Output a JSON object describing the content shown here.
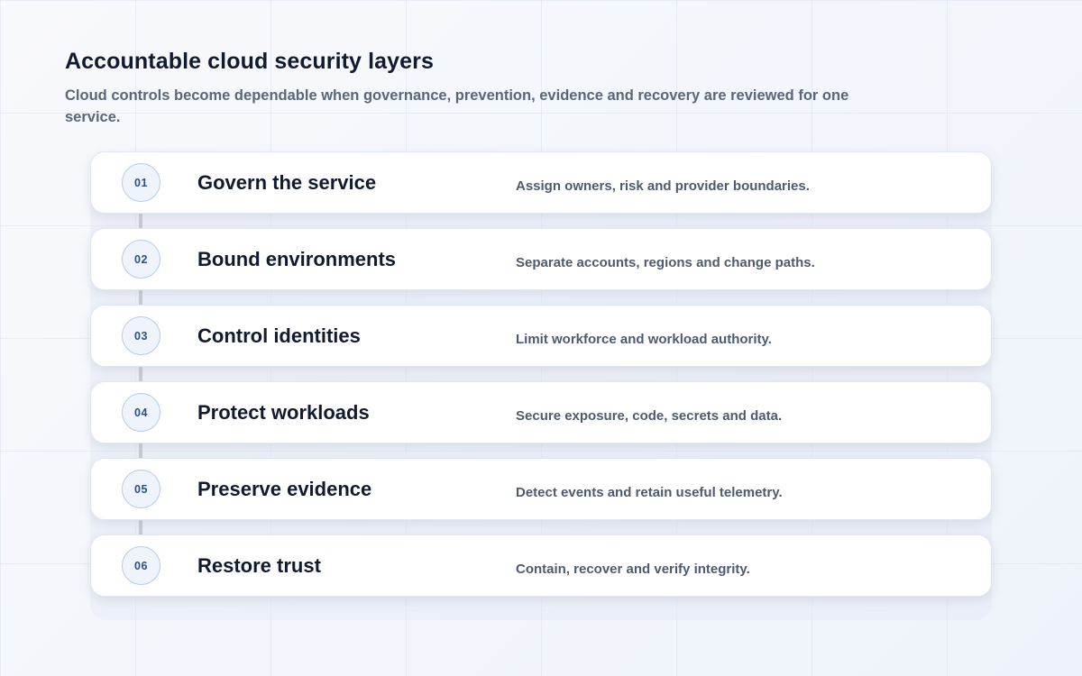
{
  "header": {
    "title": "Accountable cloud security layers",
    "subtitle": "Cloud controls become dependable when governance, prevention, evidence and recovery are reviewed for one service."
  },
  "colors": {
    "background": "#f5f7fb",
    "card": "#ffffff",
    "badge_fill": "#eff4fc",
    "badge_border": "#b6cbe9",
    "badge_text": "#2e4f86",
    "connector": "#c9ccd3",
    "title_text": "#111a2e",
    "description_text": "#4e5a70"
  },
  "layers": [
    {
      "number": "01",
      "name": "Govern the service",
      "description": "Assign owners, risk and provider boundaries."
    },
    {
      "number": "02",
      "name": "Bound environments",
      "description": "Separate accounts, regions and change paths."
    },
    {
      "number": "03",
      "name": "Control identities",
      "description": "Limit workforce and workload authority."
    },
    {
      "number": "04",
      "name": "Protect workloads",
      "description": "Secure exposure, code, secrets and data."
    },
    {
      "number": "05",
      "name": "Preserve evidence",
      "description": "Detect events and retain useful telemetry."
    },
    {
      "number": "06",
      "name": "Restore trust",
      "description": "Contain, recover and verify integrity."
    }
  ]
}
